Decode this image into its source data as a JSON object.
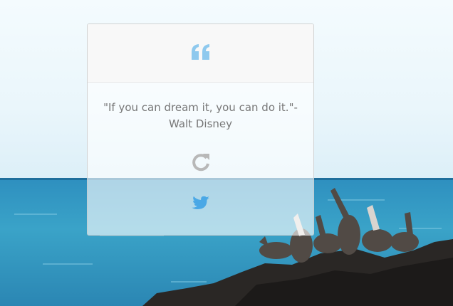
{
  "quote": {
    "text": "\"If you can dream it, you can do it.\"-",
    "author": "Walt Disney"
  },
  "icons": {
    "quote": "quote-left-icon",
    "refresh": "refresh-icon",
    "tweet": "twitter-icon"
  },
  "colors": {
    "accent": "#8ec9ee",
    "refresh": "#b8b8b8",
    "twitter": "#4aa8e6"
  }
}
